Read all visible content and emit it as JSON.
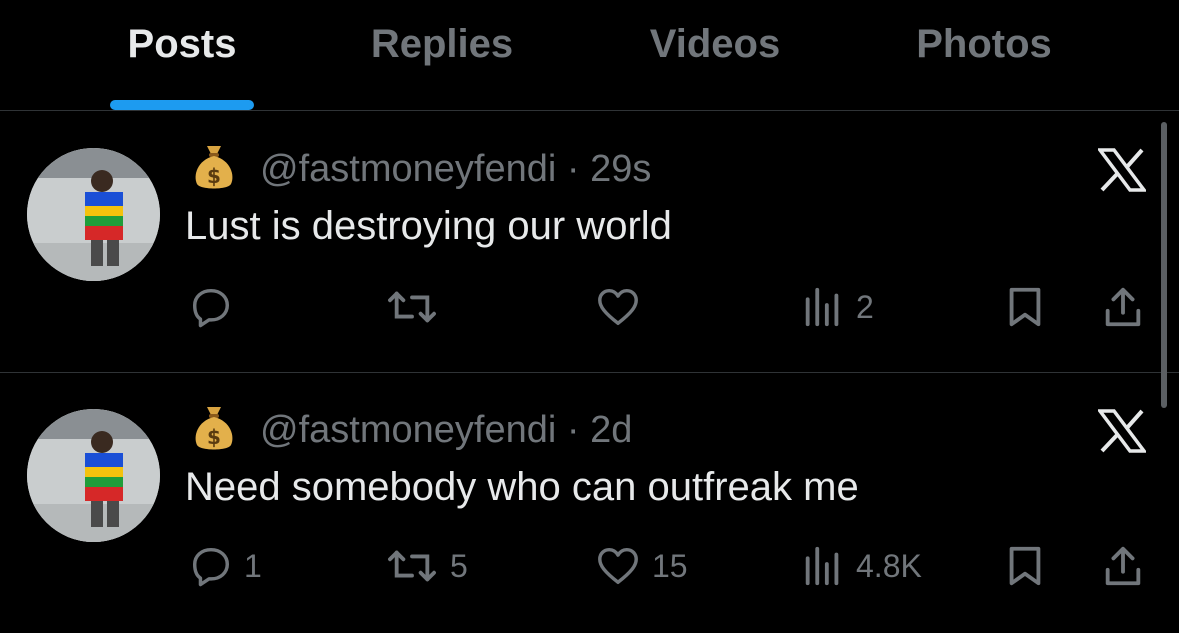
{
  "tabs": [
    {
      "label": "Posts",
      "active": true
    },
    {
      "label": "Replies",
      "active": false
    },
    {
      "label": "Videos",
      "active": false
    },
    {
      "label": "Photos",
      "active": false
    }
  ],
  "posts": [
    {
      "handle": "@fastmoneyfendi",
      "separator": "·",
      "time": "29s",
      "text": "Lust is destroying our world",
      "replies": "",
      "reposts": "",
      "likes": "",
      "views": "2"
    },
    {
      "handle": "@fastmoneyfendi",
      "separator": "·",
      "time": "2d",
      "text": "Need somebody who can outfreak me",
      "replies": "1",
      "reposts": "5",
      "likes": "15",
      "views": "4.8K"
    }
  ],
  "icons": {
    "reply": "reply-icon",
    "repost": "repost-icon",
    "like": "heart-icon",
    "views": "views-icon",
    "bookmark": "bookmark-icon",
    "share": "share-icon",
    "platform": "x-logo-icon",
    "emoji": "money-bag-emoji"
  },
  "colors": {
    "background": "#000000",
    "primary_text": "#e7e9ea",
    "secondary_text": "#71767b",
    "accent": "#1d9bf0",
    "divider": "#2f3336"
  }
}
